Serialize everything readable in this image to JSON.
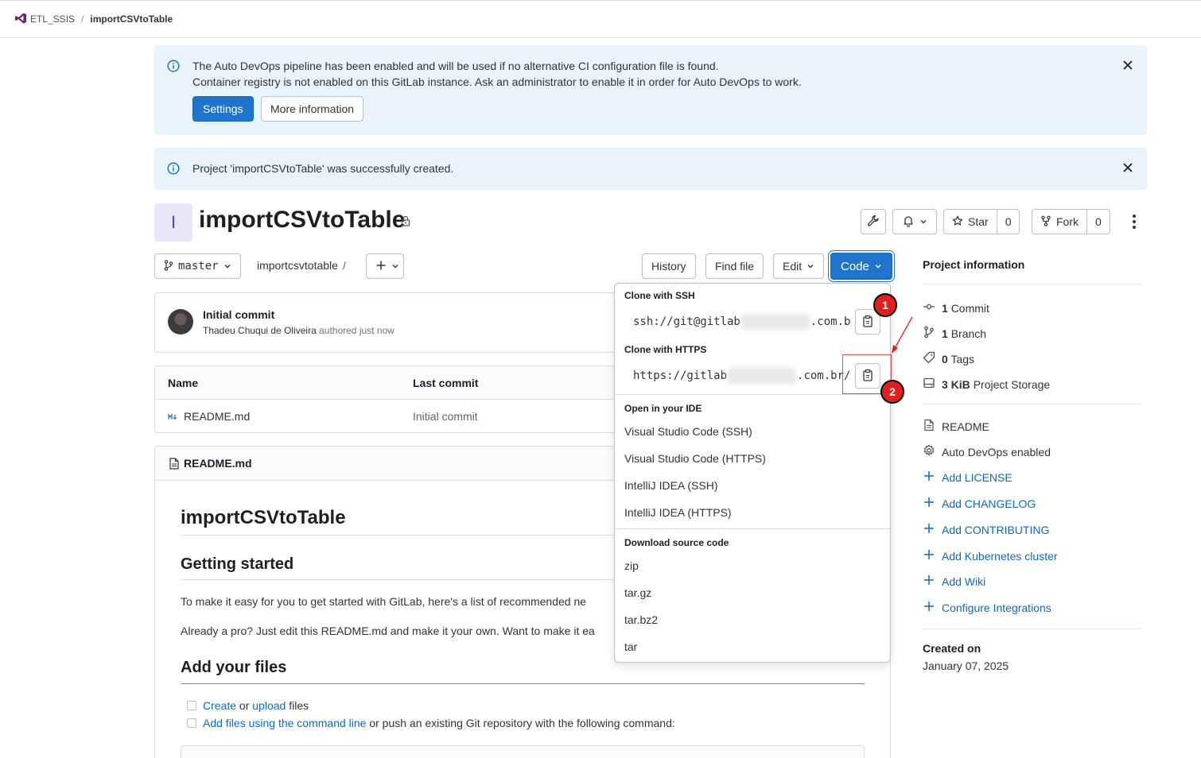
{
  "breadcrumb": {
    "group": "ETL_SSIS",
    "project": "importCSVtoTable"
  },
  "alert_autodevops": {
    "line1": "The Auto DevOps pipeline has been enabled and will be used if no alternative CI configuration file is found.",
    "line2": "Container registry is not enabled on this GitLab instance. Ask an administrator to enable it in order for Auto DevOps to work.",
    "settings_label": "Settings",
    "more_label": "More information"
  },
  "alert_created": {
    "text": "Project 'importCSVtoTable' was successfully created."
  },
  "project": {
    "avatar_letter": "I",
    "title": "importCSVtoTable"
  },
  "header_actions": {
    "star_label": "Star",
    "star_count": "0",
    "fork_label": "Fork",
    "fork_count": "0"
  },
  "repo": {
    "branch": "master",
    "path": "importcsvtotable",
    "path_sep": "/",
    "history_label": "History",
    "find_file_label": "Find file",
    "edit_label": "Edit",
    "code_label": "Code"
  },
  "commit": {
    "title": "Initial commit",
    "author": "Thadeu Chuqui de Oliveira",
    "authored": "authored",
    "when": "just now"
  },
  "file_table": {
    "headers": [
      "Name",
      "Last commit"
    ],
    "rows": [
      {
        "name": "README.md",
        "last_commit": "Initial commit"
      }
    ]
  },
  "readme": {
    "filename": "README.md",
    "h1": "importCSVtoTable",
    "h2_getting_started": "Getting started",
    "p1": "To make it easy for you to get started with GitLab, here's a list of recommended ne",
    "p2": "Already a pro? Just edit this README.md and make it your own. Want to make it ea",
    "h2_add_files": "Add your files",
    "task1": {
      "create": "Create",
      "or": " or ",
      "upload": "upload",
      "rest": " files"
    },
    "task2": {
      "link": "Add files using the command line",
      "rest": " or push an existing Git repository with the following command:"
    }
  },
  "code_dropdown": {
    "ssh_heading": "Clone with SSH",
    "ssh_prefix": "ssh://git@gitlab",
    "ssh_suffix": ".com.b",
    "https_heading": "Clone with HTTPS",
    "https_prefix": "https://gitlab",
    "https_suffix": ".com.br/",
    "ide_heading": "Open in your IDE",
    "ide_items": [
      "Visual Studio Code (SSH)",
      "Visual Studio Code (HTTPS)",
      "IntelliJ IDEA (SSH)",
      "IntelliJ IDEA (HTTPS)"
    ],
    "download_heading": "Download source code",
    "download_items": [
      "zip",
      "tar.gz",
      "tar.bz2",
      "tar"
    ]
  },
  "annotations": {
    "badge1": "1",
    "badge2": "2",
    "color": "#e02020"
  },
  "sidebar": {
    "title": "Project information",
    "stats": [
      {
        "count": "1",
        "label": "Commit",
        "icon": "commit-icon"
      },
      {
        "count": "1",
        "label": "Branch",
        "icon": "branch-icon"
      },
      {
        "count": "0",
        "label": "Tags",
        "icon": "tag-icon"
      },
      {
        "count": "3 KiB",
        "label": "Project Storage",
        "icon": "storage-icon"
      }
    ],
    "links": [
      {
        "label": "README",
        "icon": "document-icon"
      },
      {
        "label": "Auto DevOps enabled",
        "icon": "gear-icon"
      },
      {
        "label": "Add LICENSE",
        "icon": "plus-icon"
      },
      {
        "label": "Add CHANGELOG",
        "icon": "plus-icon"
      },
      {
        "label": "Add CONTRIBUTING",
        "icon": "plus-icon"
      },
      {
        "label": "Add Kubernetes cluster",
        "icon": "plus-icon"
      },
      {
        "label": "Add Wiki",
        "icon": "plus-icon"
      },
      {
        "label": "Configure Integrations",
        "icon": "plus-icon"
      }
    ],
    "created_label": "Created on",
    "created_value": "January 07, 2025"
  },
  "colors": {
    "accent": "#1f75cb",
    "link": "#1068bf",
    "alert_bg": "#e9f3fc"
  }
}
